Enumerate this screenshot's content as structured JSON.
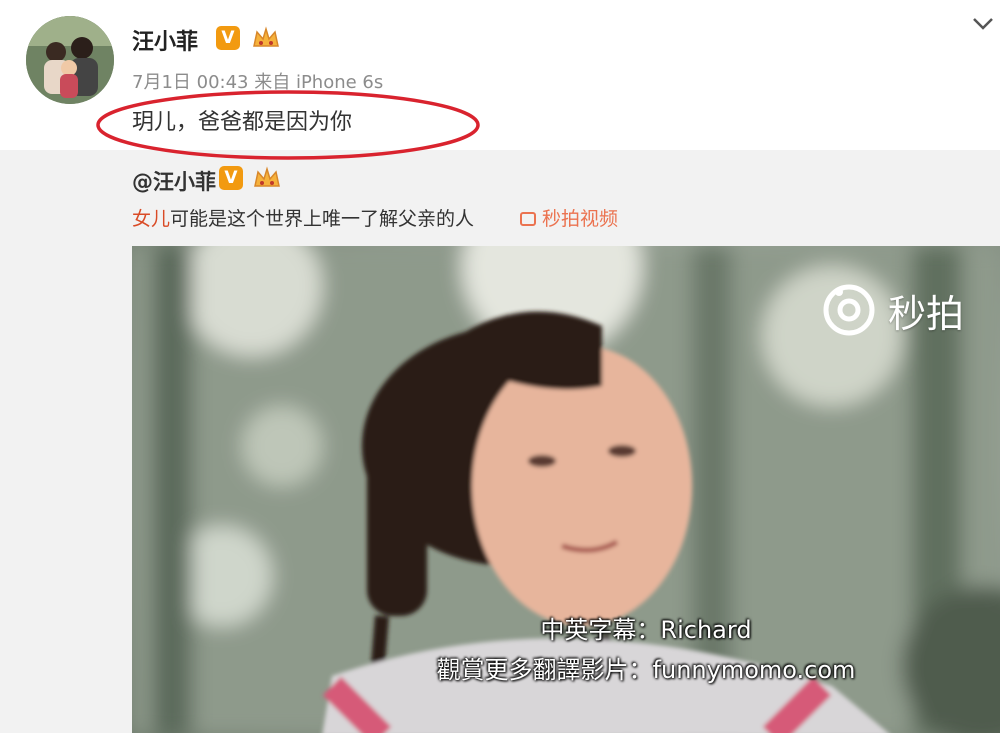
{
  "post": {
    "author": "汪小菲",
    "verified_badge": "V",
    "meta": "7月1日 00:43 来自 iPhone 6s",
    "content": "玥儿，爸爸都是因为你",
    "annotation_color": "#d9232e"
  },
  "repost": {
    "author": "@汪小菲",
    "verified_badge": "V",
    "text_highlight": "女儿",
    "text_rest": "可能是这个世界上唯一了解父亲的人",
    "link_label": "秒拍视频"
  },
  "video": {
    "watermark": "秒拍",
    "subtitle_1": "中英字幕：Richard",
    "subtitle_2": "觀賞更多翻譯影片：funnymomo.com"
  },
  "icons": [
    "avatar-photo",
    "verified-badge-icon",
    "vip-crown-icon",
    "chevron-down-icon",
    "video-link-icon",
    "miaopai-logo-icon"
  ],
  "colors": {
    "badge": "#f29a10",
    "link": "#eb7350",
    "highlight": "#d94b26",
    "repost_bg": "#f2f2f2"
  }
}
